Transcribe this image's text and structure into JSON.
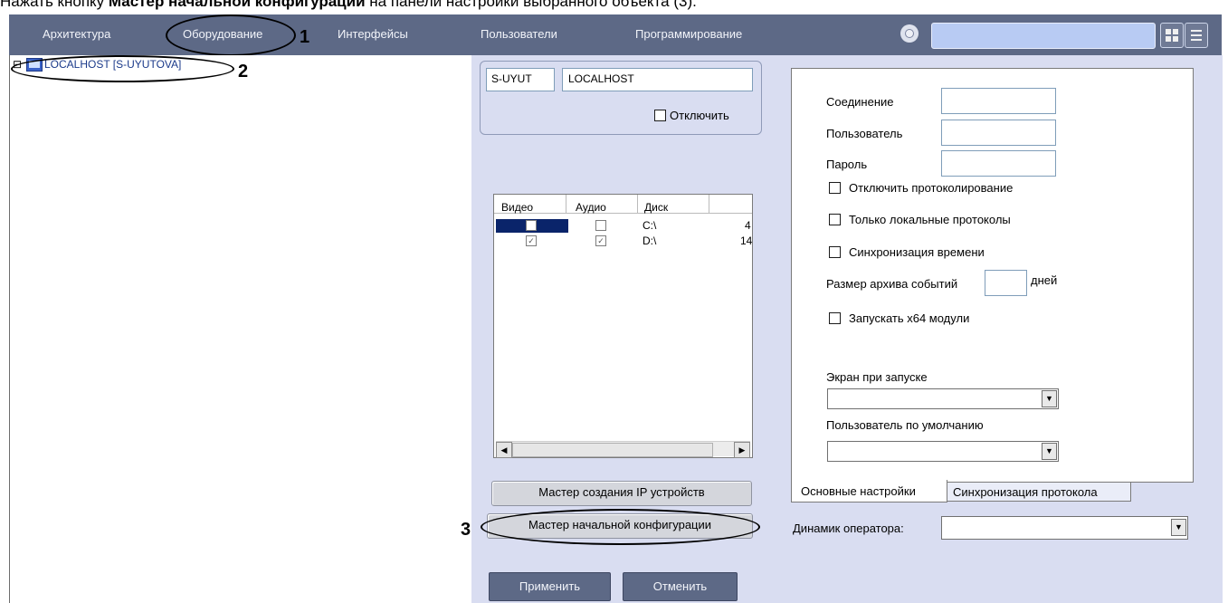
{
  "caption": {
    "prefix": "Нажать кнопку ",
    "bold": "Мастер начальной конфигурации",
    "suffix": " на панели настройки выбранного объекта (3)."
  },
  "nav": {
    "items": [
      "Архитектура",
      "Оборудование",
      "Интерфейсы",
      "Пользователи",
      "Программирование"
    ]
  },
  "annotations": [
    "1",
    "2",
    "3"
  ],
  "tree": {
    "expander": "⊟",
    "node_label": "LOCALHOST [S-UYUTOVA]"
  },
  "computer": {
    "id_value": "S-UYUT",
    "name_value": "LOCALHOST",
    "disable_label": "Отключить"
  },
  "disks": {
    "headers": [
      "Видео",
      "Аудио",
      "Диск"
    ],
    "rows": [
      {
        "video": false,
        "audio": false,
        "disk": "C:\\",
        "extra": "4"
      },
      {
        "video": true,
        "audio": true,
        "disk": "D:\\",
        "extra": "14"
      }
    ]
  },
  "buttons": {
    "ip_wizard": "Мастер создания IP устройств",
    "init_wizard": "Мастер начальной конфигурации",
    "apply": "Применить",
    "cancel": "Отменить"
  },
  "settings": {
    "connection_label": "Соединение",
    "user_label": "Пользователь",
    "password_label": "Пароль",
    "disable_logging": "Отключить протоколирование",
    "local_logs_only": "Только локальные протоколы",
    "time_sync": "Синхронизация времени",
    "archive_size_label": "Размер архива событий",
    "archive_days": "дней",
    "run_x64": "Запускать x64 модули",
    "startup_screen_label": "Экран при запуске",
    "default_user_label": "Пользователь по умолчанию"
  },
  "tabs": [
    "Основные настройки",
    "Синхронизация протокола"
  ],
  "operator_speaker_label": "Динамик оператора:"
}
